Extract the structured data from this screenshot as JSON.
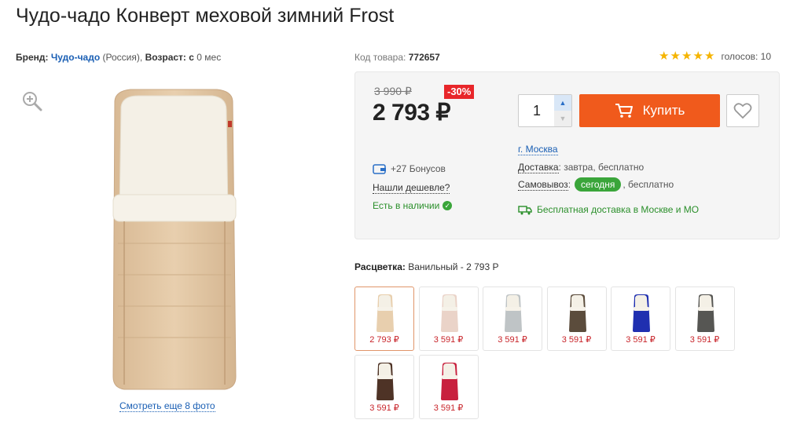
{
  "title": "Чудо-чадо Конверт меховой зимний Frost",
  "meta": {
    "brand_label": "Бренд:",
    "brand": "Чудо-чадо",
    "country": "(Россия),",
    "age_label": "Возраст:",
    "age_from": "с",
    "age_value": "0 мес"
  },
  "code": {
    "label": "Код товара:",
    "value": "772657"
  },
  "rating": {
    "stars": 5,
    "votes_label": "голосов: 10"
  },
  "gallery": {
    "more_photos": "Смотреть еще 8 фото"
  },
  "buybox": {
    "old_price": "3 990 ₽",
    "discount": "-30%",
    "price": "2 793 ₽",
    "quantity": "1",
    "buy_label": "Купить",
    "bonus": "+27 Бонусов",
    "cheaper": "Нашли дешевле?",
    "in_stock": "Есть в наличии",
    "city": "г. Москва",
    "delivery_label": "Доставка",
    "delivery_value": ": завтра, бесплатно",
    "pickup_label": "Самовывоз",
    "pickup_badge": "сегодня",
    "pickup_value": ", бесплатно",
    "free_shipping": "Бесплатная доставка в Москве и МО"
  },
  "colour": {
    "label": "Расцветка:",
    "value": "Ванильный - 2 793 Р"
  },
  "swatches": [
    {
      "price": "2 793 ₽",
      "color": "#e8cfae",
      "active": true
    },
    {
      "price": "3 591 ₽",
      "color": "#ead3c8",
      "active": false
    },
    {
      "price": "3 591 ₽",
      "color": "#bfc4c6",
      "active": false
    },
    {
      "price": "3 591 ₽",
      "color": "#5b4c3c",
      "active": false
    },
    {
      "price": "3 591 ₽",
      "color": "#1f2fb0",
      "active": false
    },
    {
      "price": "3 591 ₽",
      "color": "#565653",
      "active": false
    },
    {
      "price": "3 591 ₽",
      "color": "#4e3326",
      "active": false
    },
    {
      "price": "3 591 ₽",
      "color": "#c8203e",
      "active": false
    }
  ],
  "colors": {
    "accent": "#f05a1c",
    "link": "#1a5fb4",
    "sale": "#e8262a",
    "instock": "#2a8f2a"
  }
}
